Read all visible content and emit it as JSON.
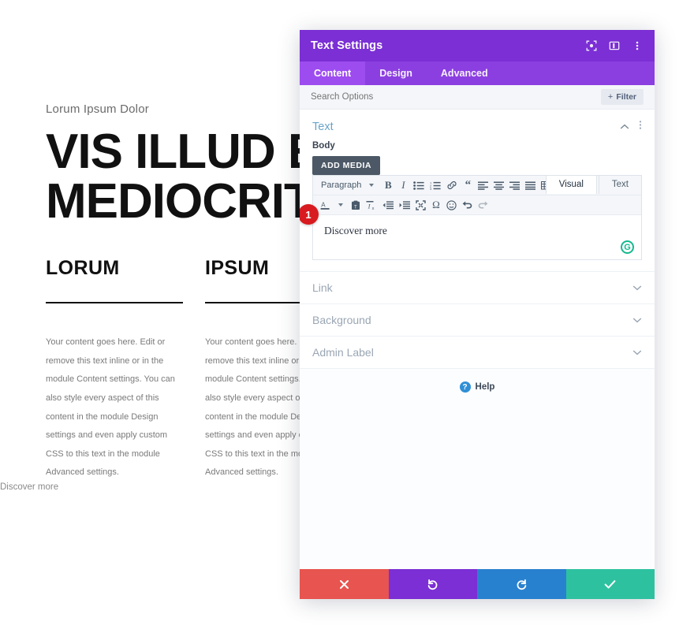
{
  "page": {
    "eyebrow": "Lorum Ipsum Dolor",
    "title_line1": "VIS ILLUD EX",
    "title_line2": "MEDIOCRITA",
    "columns": [
      {
        "heading": "LORUM",
        "body": "Your content goes here. Edit or remove this text inline or in the module Content settings. You can also style every aspect of this content in the module Design settings and even apply custom CSS to this text in the module Advanced settings."
      },
      {
        "heading": "IPSUM",
        "body": "Your content goes here. Edit or remove this text inline or in the module Content settings. You can also style every aspect of this content in the module Design settings and even apply custom CSS to this text in the module Advanced settings."
      }
    ],
    "bottom_link": "Discover more"
  },
  "modal": {
    "title": "Text Settings",
    "header_icons": [
      {
        "name": "fullscreen-icon"
      },
      {
        "name": "layout-view-icon"
      },
      {
        "name": "kebab-menu-icon"
      }
    ],
    "tabs": [
      {
        "label": "Content",
        "active": true
      },
      {
        "label": "Design",
        "active": false
      },
      {
        "label": "Advanced",
        "active": false
      }
    ],
    "search": {
      "placeholder": "Search Options",
      "value": ""
    },
    "filter_button": "Filter",
    "open_section": {
      "title": "Text",
      "field_label": "Body",
      "add_media_button": "ADD MEDIA",
      "editor_tabs": [
        {
          "label": "Visual",
          "active": true
        },
        {
          "label": "Text",
          "active": false
        }
      ],
      "format_select": "Paragraph",
      "editor_content": "Discover more",
      "marker_badge": "1",
      "grammarly_icon": "G"
    },
    "closed_sections": [
      {
        "title": "Link"
      },
      {
        "title": "Background"
      },
      {
        "title": "Admin Label"
      }
    ],
    "help": {
      "label": "Help",
      "icon_glyph": "?"
    },
    "actions": [
      {
        "name": "cancel-button",
        "glyph": "x",
        "color": "#e8544f"
      },
      {
        "name": "undo-button",
        "glyph": "undo",
        "color": "#7b2fd4"
      },
      {
        "name": "redo-button",
        "glyph": "redo",
        "color": "#2881cf"
      },
      {
        "name": "save-button",
        "glyph": "check",
        "color": "#2ec1a0"
      }
    ],
    "colors": {
      "header": "#7b2fd4",
      "tabs": "#8c3fe0",
      "tab_active": "#9d4cf0",
      "section_title": "#6aa4c8",
      "badge": "#d81b20"
    }
  }
}
